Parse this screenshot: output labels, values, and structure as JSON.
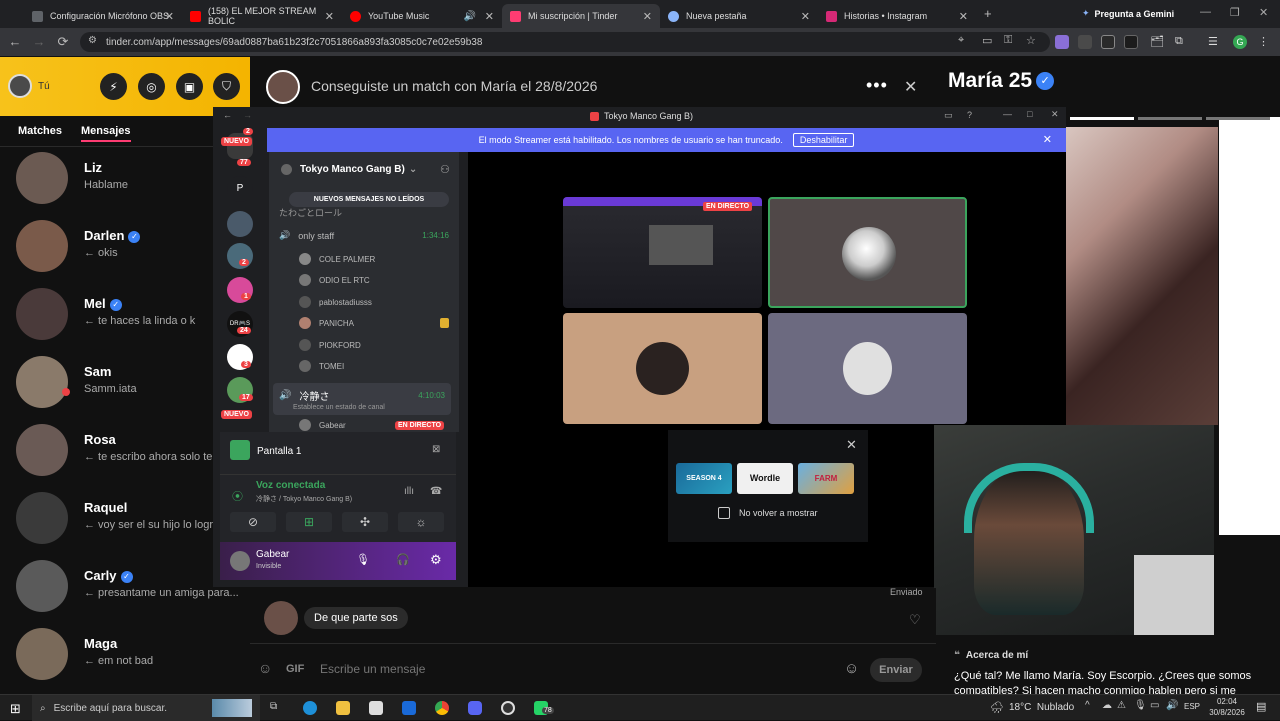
{
  "browser": {
    "tabs": [
      {
        "label": "Configuración Micrófono OBS",
        "color": "#5f6368"
      },
      {
        "label": "(158) EL MEJOR STREAM BOLIC",
        "color": "#ff0000"
      },
      {
        "label": "YouTube Music",
        "color": "#ff0000"
      },
      {
        "label": "Mi suscripción | Tinder",
        "color": "#fe3c72"
      },
      {
        "label": "Nueva pestaña",
        "color": "#8ab4f8"
      },
      {
        "label": "Historias • Instagram",
        "color": "#d62976"
      }
    ],
    "gemini_label": "Pregunta a Gemini",
    "url": "tinder.com/app/messages/69ad0887ba61b23f2c7051866a893fa3085c0c7e02e59b38",
    "profile_initial": "G"
  },
  "tinder": {
    "you_label": "Tú",
    "tab_matches": "Matches",
    "tab_messages": "Mensajes",
    "matches": [
      {
        "name": "Liz",
        "msg": "Hablame",
        "verified": false,
        "avatar": "#6b5a52",
        "online": false
      },
      {
        "name": "Darlen",
        "msg": "← okis",
        "verified": true,
        "avatar": "#7a5a4a",
        "online": false
      },
      {
        "name": "Mel",
        "msg": "← te haces la linda o k",
        "verified": true,
        "avatar": "#4a3a3a",
        "online": false
      },
      {
        "name": "Sam",
        "msg": "Samm.iata",
        "verified": false,
        "avatar": "#8a7a6a",
        "online": true
      },
      {
        "name": "Rosa",
        "msg": "← te escribo ahora solo te",
        "verified": false,
        "avatar": "#6a5a55",
        "online": false
      },
      {
        "name": "Raquel",
        "msg": "← voy ser el su hijo lo logr",
        "verified": false,
        "avatar": "#3a3a3a",
        "online": false
      },
      {
        "name": "Carly",
        "msg": "← presantame un amiga para...",
        "verified": true,
        "avatar": "#5a5a5a",
        "online": false
      },
      {
        "name": "Maga",
        "msg": "← em not bad",
        "verified": false,
        "avatar": "#7a6a5a",
        "online": false
      }
    ],
    "chat_header": "Conseguiste un match con María el 28/8/2026",
    "sent_label": "Enviado",
    "message": "De que parte sos",
    "gif_label": "GIF",
    "input_placeholder": "Escribe un mensaje",
    "send_label": "Enviar",
    "profile_name": "María 25",
    "about_title": "Acerca de mí",
    "about_text": "¿Qué tal? Me llamo María. Soy Escorpio. ¿Crees que somos compatibles? Si hacen macho conmigo hablen pero si me"
  },
  "discord": {
    "window_title": "Tokyo Manco Gang B)",
    "streamer_banner": "El modo Streamer está habilitado. Los nombres de usuario se han truncado.",
    "disable_label": "Deshabilitar",
    "server_name": "Tokyo Manco Gang B)",
    "unread_label": "NUEVOS MENSAJES NO LEÍDOS",
    "channel_partial": "たわごとロール",
    "voice_channel": "only staff",
    "voice_time": "1:34:16",
    "users": [
      "COLE PALMER",
      "ODIO EL RTC",
      "pablostadiusss",
      "PANICHA",
      "PIOKFORD",
      "TOMEI"
    ],
    "channel2": "冷静さ",
    "channel2_time": "4:10:03",
    "channel2_status": "Establece un estado de canal",
    "gabear_partial": "Gabear",
    "live_label": "EN DIRECTO",
    "badges": {
      "new": "NUEVO",
      "b1": "2",
      "b2": "77",
      "b3": "2",
      "b4": "1",
      "b5": "24",
      "b6": "3",
      "b7": "17",
      "p": "P",
      "dr": "DR🎮S"
    },
    "screen_label": "Pantalla 1",
    "voice_connected": "Voz conectada",
    "voice_channel_path": "冷静さ / Tokyo Manco Gang B)",
    "user_name": "Gabear",
    "user_status": "Invisible",
    "live_tag": "EN DIRECTO",
    "games": [
      "SEASON 4",
      "Wordle",
      "FARM"
    ],
    "dont_show": "No volver a mostrar"
  },
  "taskbar": {
    "search_placeholder": "Escribe aquí para buscar.",
    "weather": "18°C  Nublado",
    "lang": "ESP",
    "time": "02:04",
    "date": "30/8/2026",
    "notif_count": "78"
  }
}
